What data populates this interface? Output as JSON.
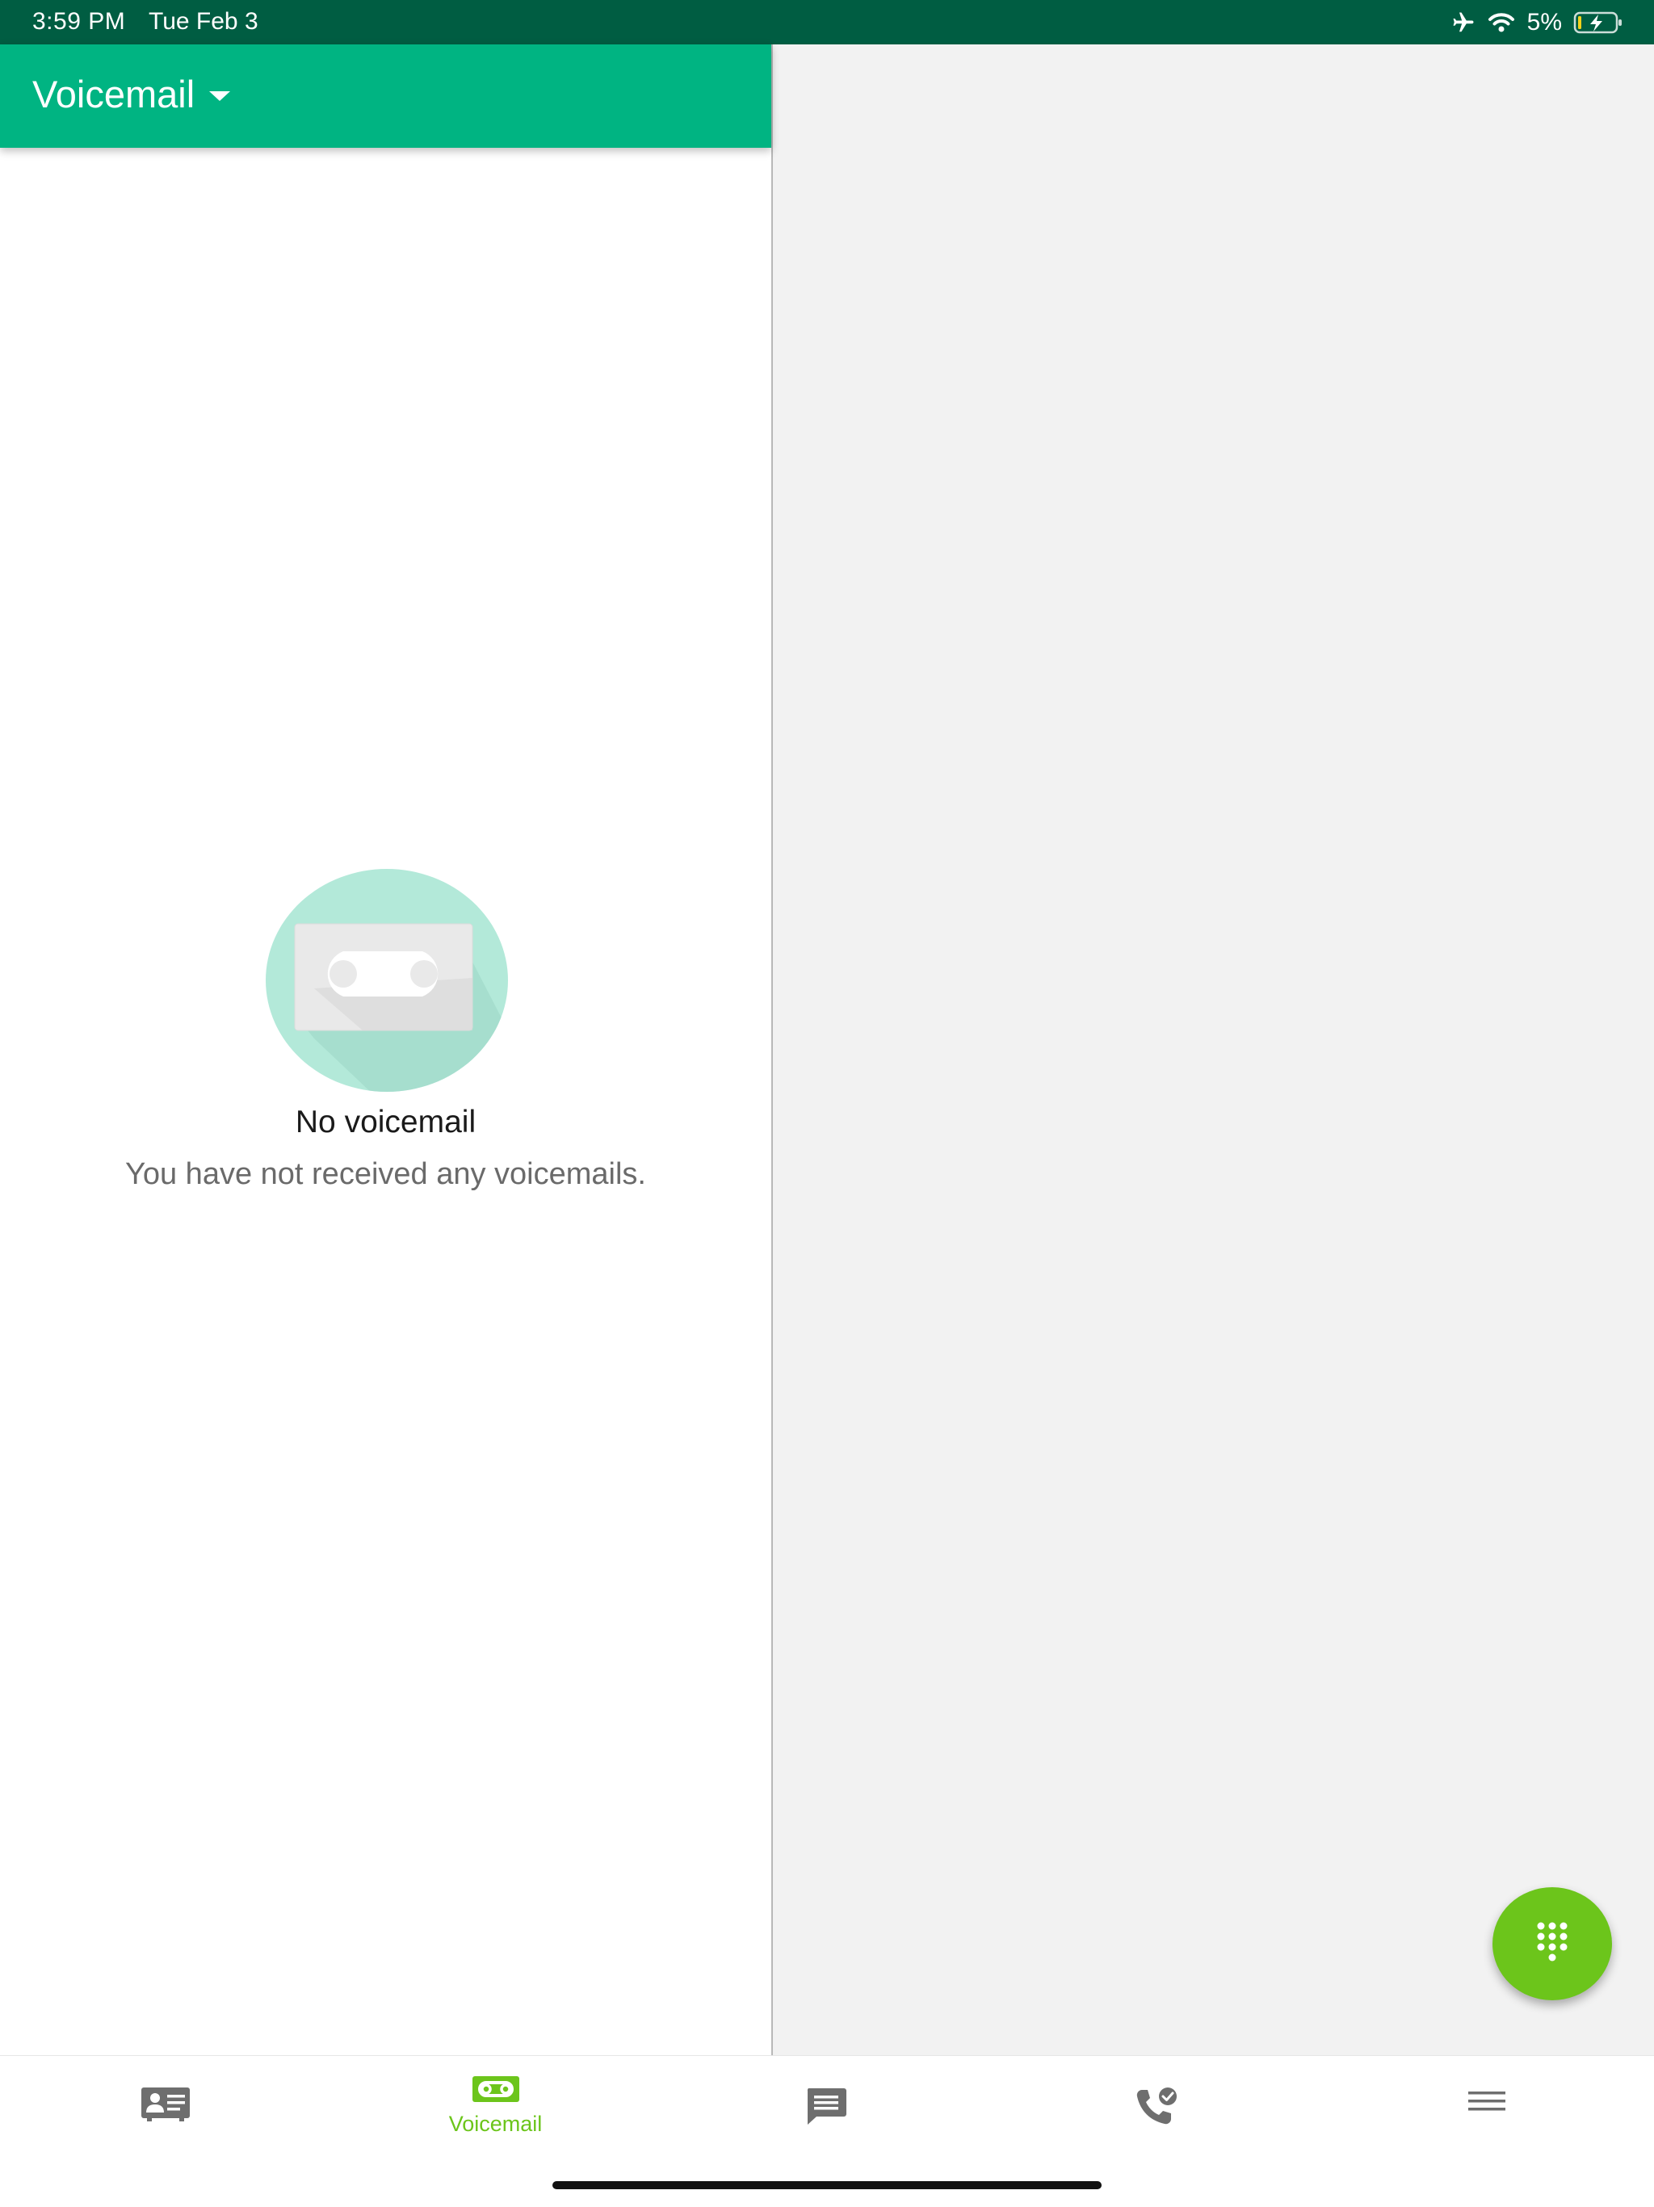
{
  "status_bar": {
    "time": "3:59 PM",
    "date": "Tue Feb 3",
    "battery": "5%",
    "icons": [
      "airplane-icon",
      "wifi-icon",
      "battery-charging-icon"
    ]
  },
  "header": {
    "title": "Voicemail"
  },
  "empty_state": {
    "title": "No voicemail",
    "subtitle": "You have not received any voicemails."
  },
  "bottom_nav": {
    "items": [
      {
        "icon": "contacts-card-icon",
        "label": ""
      },
      {
        "icon": "voicemail-icon",
        "label": "Voicemail"
      },
      {
        "icon": "message-icon",
        "label": ""
      },
      {
        "icon": "call-history-icon",
        "label": ""
      },
      {
        "icon": "menu-icon",
        "label": ""
      }
    ]
  },
  "colors": {
    "status_bar": "#005d42",
    "header": "#00b482",
    "accent": "#6cc51b",
    "empty_circle": "#b3e9d9",
    "right_pane": "#f2f2f2"
  }
}
